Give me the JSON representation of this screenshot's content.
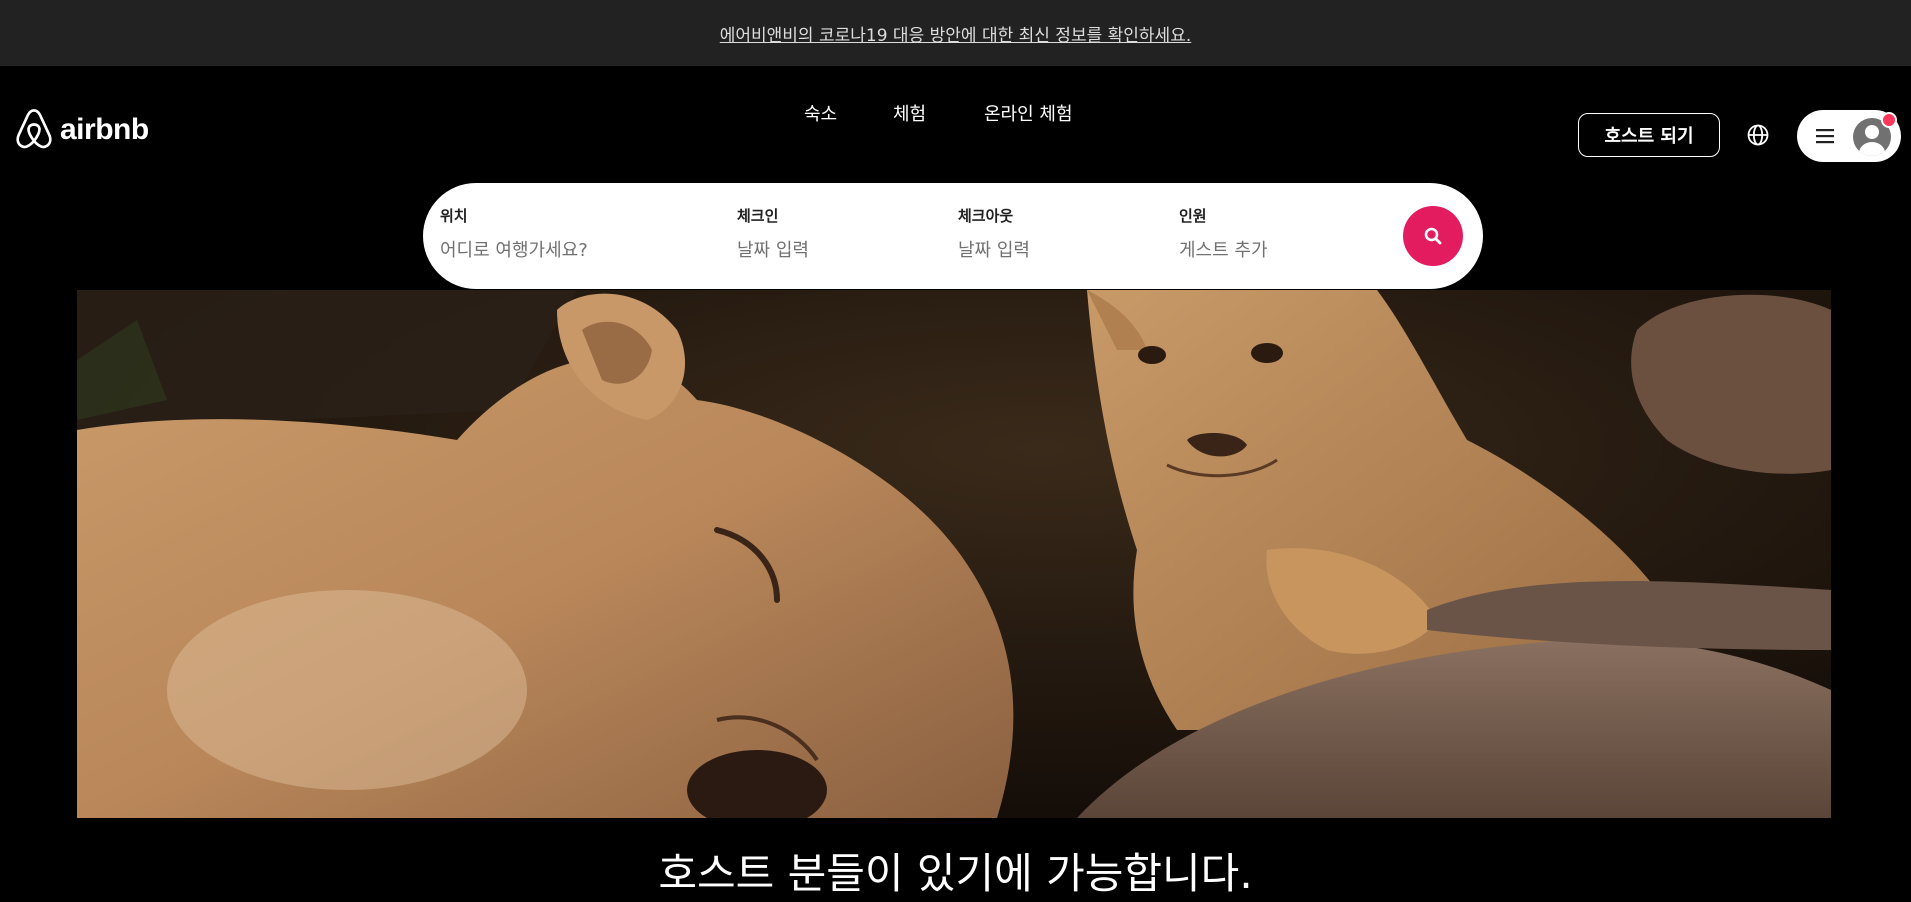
{
  "banner": {
    "text": "에어비앤비의 코로나19 대응 방안에 대한 최신 정보를 확인하세요."
  },
  "header": {
    "logo_text": "airbnb",
    "nav": [
      {
        "label": "숙소"
      },
      {
        "label": "체험"
      },
      {
        "label": "온라인 체험"
      }
    ],
    "host_button": "호스트 되기",
    "globe_icon": "globe-icon",
    "menu_icon": "hamburger-menu-icon",
    "notification_color": "#ff385c"
  },
  "search": {
    "location_label": "위치",
    "location_placeholder": "어디로 여행가세요?",
    "checkin_label": "체크인",
    "checkin_placeholder": "날짜 입력",
    "checkout_label": "체크아웃",
    "checkout_placeholder": "날짜 입력",
    "guests_label": "인원",
    "guests_placeholder": "게스트 추가",
    "button_color": "#e31c5f"
  },
  "hero": {
    "tagline": "호스트 분들이 있기에 가능합니다."
  }
}
